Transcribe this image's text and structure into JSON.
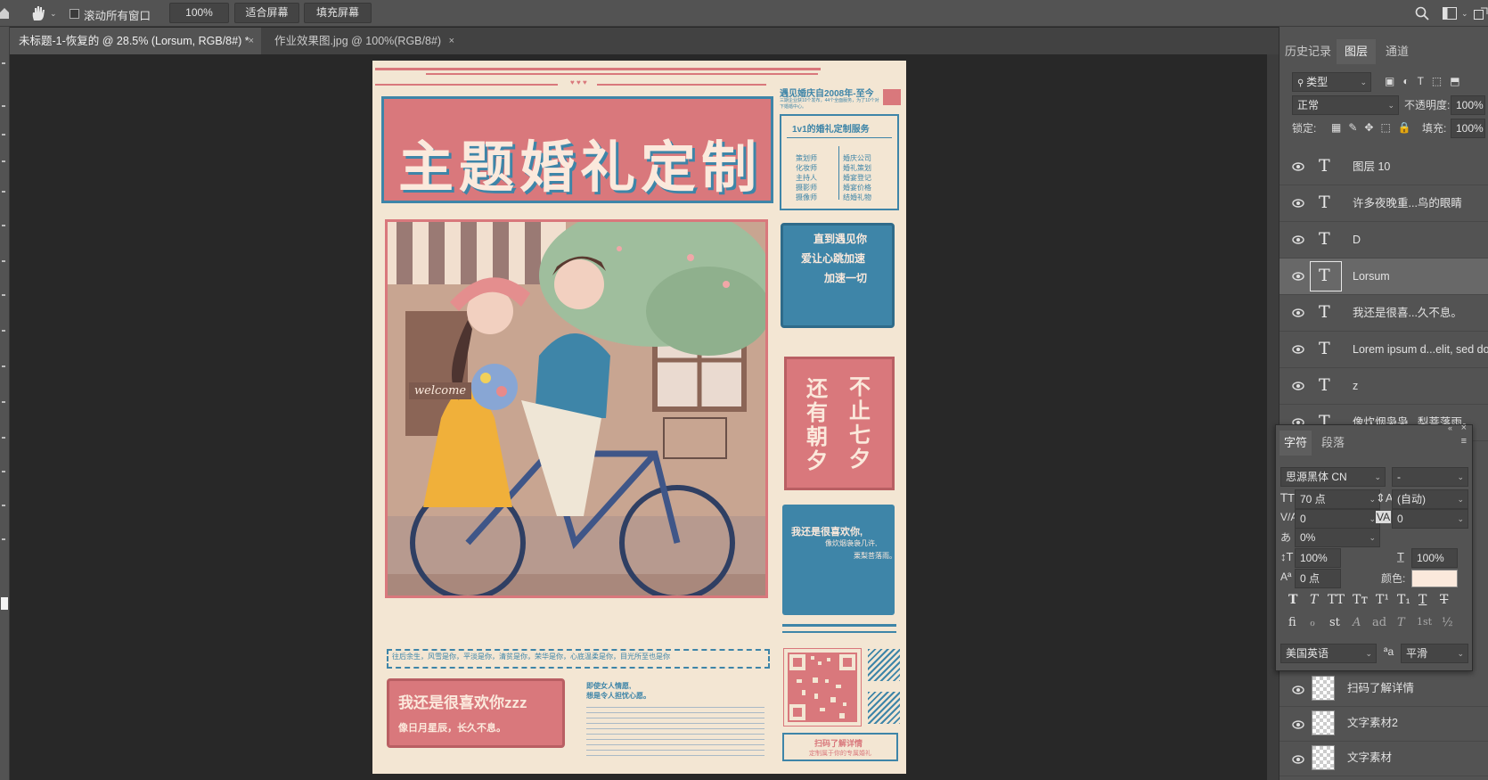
{
  "options_bar": {
    "scroll_all_label": "滚动所有窗口",
    "zoom_value": "100%",
    "fit_screen": "适合屏幕",
    "fill_screen": "填充屏幕"
  },
  "tabs": [
    {
      "label": "未标题-1-恢复的 @ 28.5% (Lorsum, RGB/8#) *",
      "close": "×"
    },
    {
      "label": "作业效果图.jpg @ 100%(RGB/8#)",
      "close": "×"
    }
  ],
  "poster": {
    "main_title": "主题婚礼定制",
    "brand_line": "遇见婚庆自2008年-至今",
    "brand_sub": "三期企业获10个发布，44个全面服务，为了10个对下婚婚中心。",
    "service_title": "1v1的婚礼定制服务",
    "services_left": [
      "策划师",
      "化妆师",
      "主持人",
      "摄影师",
      "摄像师"
    ],
    "services_right": [
      "婚庆公司",
      "婚礼策划",
      "婚宴登记",
      "婚宴价格",
      "结婚礼物"
    ],
    "blue_card_lines": [
      "直到遇见你",
      "爱让心跳加速",
      "加速一切"
    ],
    "red_card_col1": "还有朝夕",
    "red_card_col2": "不止七夕",
    "note_title": "我还是很喜欢你,",
    "note_sub1": "像炊烟袅袅几许,",
    "note_sub2": "栗梨菩落雨。",
    "dashed_banner": "往后余生，风雪是你，平淡是你，清贫是你，荣华是你，心底温柔是你，目光所至也是你",
    "bottom_title": "我还是很喜欢你zzz",
    "bottom_sub": "像日月星辰，长久不息。",
    "mid_text1": "即使女人情愿,",
    "mid_text2": "想是令人担忧心愿。",
    "qr_caption1": "扫码了解详情",
    "qr_caption2": "定制属于你的专属婚礼",
    "welcome": "welcome"
  },
  "panel": {
    "tabs": [
      "历史记录",
      "图层",
      "通道"
    ],
    "active_tab": "图层",
    "filter_label": "类型",
    "blend_mode": "正常",
    "opacity_label": "不透明度:",
    "opacity_value": "100%",
    "lock_label": "锁定:",
    "fill_label": "填充:",
    "fill_value": "100%",
    "layers": [
      {
        "name": "图层 10",
        "kind": "text",
        "selected": false
      },
      {
        "name": "许多夜晚重...鸟的眼睛",
        "kind": "text",
        "selected": false
      },
      {
        "name": "D",
        "kind": "text",
        "selected": false
      },
      {
        "name": "Lorsum",
        "kind": "text",
        "selected": true
      },
      {
        "name": "我还是很喜...久不息。",
        "kind": "text",
        "selected": false
      },
      {
        "name": "Lorem ipsum d...elit, sed do",
        "kind": "text",
        "selected": false
      },
      {
        "name": "z",
        "kind": "text",
        "selected": false
      },
      {
        "name": "像炊烟袅袅...梨菩落雨。",
        "kind": "text",
        "selected": false
      }
    ],
    "bottom_layers": [
      {
        "name": "扫码了解详情",
        "kind": "smart"
      },
      {
        "name": "文字素材2",
        "kind": "smart"
      },
      {
        "name": "文字素材",
        "kind": "smart"
      }
    ]
  },
  "character": {
    "tabs": [
      "字符",
      "段落"
    ],
    "font_family": "思源黑体 CN",
    "font_style": "-",
    "font_size": "70 点",
    "leading": "(自动)",
    "kerning": "0",
    "tracking": "0",
    "tsume": "0%",
    "vscale": "100%",
    "hscale": "100%",
    "baseline": "0 点",
    "color_label": "颜色:",
    "color_value": "#fbe9dc",
    "language": "美国英语",
    "aa_label": "ªa",
    "antialias": "平滑",
    "type_buttons": [
      "T",
      "T",
      "TT",
      "Tт",
      "T¹",
      "T₁",
      "T",
      "T"
    ],
    "opentype_buttons": [
      "fi",
      "ℴ",
      "st",
      "A",
      "ad",
      "T",
      "1st",
      "½"
    ]
  },
  "colors": {
    "poster_bg": "#f3e6d3",
    "poster_red": "#d9787c",
    "poster_blue": "#3e85a8",
    "panel_bg": "#535353",
    "selected_layer": "#686868"
  }
}
